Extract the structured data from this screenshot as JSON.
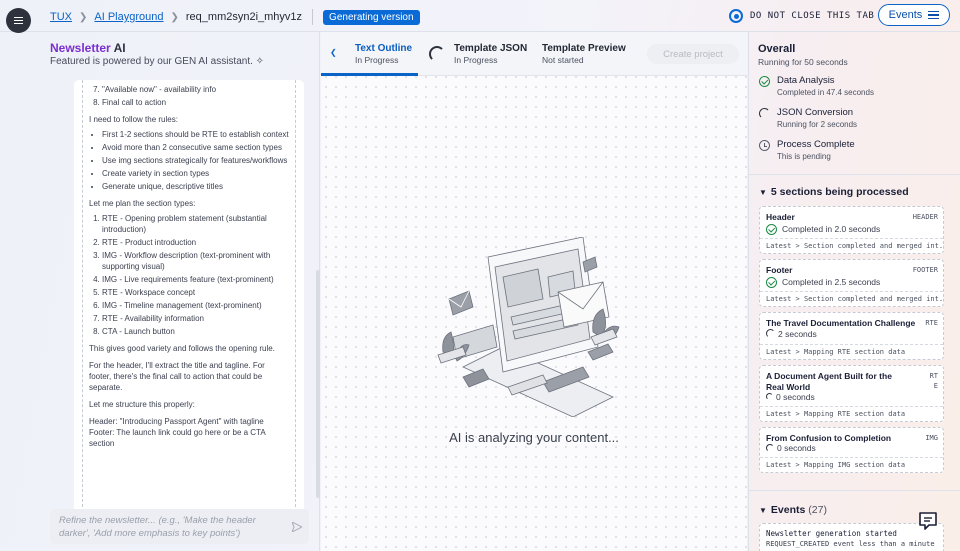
{
  "topbar": {
    "crumbs": [
      "TUX",
      "AI Playground",
      "req_mm2syn2i_mhyv1z"
    ],
    "badge": "Generating version",
    "warning": "DO NOT CLOSE THIS TAB",
    "events_button": "Events"
  },
  "left_panel": {
    "title_brand": "Newsletter",
    "title_suffix": "AI",
    "subtitle": "Featured is powered by our GEN AI assistant.",
    "chat": {
      "list_a_start": 7,
      "list_a": [
        "\"Available now\" - availability info",
        "Final call to action"
      ],
      "para_rules": "I need to follow the rules:",
      "rules": [
        "First 1-2 sections should be RTE to establish context",
        "Avoid more than 2 consecutive same section types",
        "Use img sections strategically for features/workflows",
        "Create variety in section types",
        "Generate unique, descriptive titles"
      ],
      "para_plan": "Let me plan the section types:",
      "plan": [
        "RTE - Opening problem statement (substantial introduction)",
        "RTE - Product introduction",
        "IMG - Workflow description (text-prominent with supporting visual)",
        "IMG - Live requirements feature (text-prominent)",
        "RTE - Workspace concept",
        "IMG - Timeline management (text-prominent)",
        "RTE - Availability information",
        "CTA - Launch button"
      ],
      "para_variety": "This gives good variety and follows the opening rule.",
      "para_header": "For the header, I'll extract the title and tagline. For footer, there's the final call to action that could be separate.",
      "para_structure": "Let me structure this properly:",
      "para_final": "Header: \"Introducing Passport Agent\" with tagline Footer: The launch link could go here or be a CTA section"
    },
    "refine_placeholder": "Refine the newsletter... (e.g., 'Make the header darker', 'Add more emphasis to key points')"
  },
  "middle": {
    "tabs": [
      {
        "label": "Text Outline",
        "status": "In Progress"
      },
      {
        "label": "Template JSON",
        "status": "In Progress"
      },
      {
        "label": "Template Preview",
        "status": "Not started"
      }
    ],
    "create_button": "Create project",
    "analyzing": "AI is analyzing your content..."
  },
  "right_panel": {
    "overall_title": "Overall",
    "overall_sub": "Running for 50 seconds",
    "steps": [
      {
        "name": "Data Analysis",
        "status": "Completed in 47.4 seconds",
        "icon": "check-icon"
      },
      {
        "name": "JSON Conversion",
        "status": "Running for 2 seconds",
        "icon": "spinner-icon"
      },
      {
        "name": "Process Complete",
        "status": "This is pending",
        "icon": "clock-icon"
      }
    ],
    "sections_heading": "5 sections being processed",
    "sections": [
      {
        "title": "Header",
        "tag": "HEADER",
        "status": "Completed in 2.0 seconds",
        "latest_label": "Latest",
        "latest": "Section completed and merged int..."
      },
      {
        "title": "Footer",
        "tag": "FOOTER",
        "status": "Completed in 2.5 seconds",
        "latest_label": "Latest",
        "latest": "Section completed and merged int..."
      },
      {
        "title": "The Travel Documentation Challenge",
        "tag": "RTE",
        "status": "2 seconds",
        "latest_label": "Latest",
        "latest": "Mapping RTE section data"
      },
      {
        "title": "A Document Agent Built for the Real World",
        "tag": "RTE",
        "status": "0 seconds",
        "latest_label": "Latest",
        "latest": "Mapping RTE section data"
      },
      {
        "title": "From Confusion to Completion",
        "tag": "IMG",
        "status": "0 seconds",
        "latest_label": "Latest",
        "latest": "Mapping IMG section data"
      }
    ],
    "events_heading": "Events",
    "events_count": "(27)",
    "event": {
      "title": "Newsletter generation started",
      "sub": "REQUEST_CREATED event less than a minute"
    }
  },
  "colors": {
    "accent": "#0b63c8",
    "brand_purple": "#7b2fd1",
    "success": "#1a8a44"
  }
}
